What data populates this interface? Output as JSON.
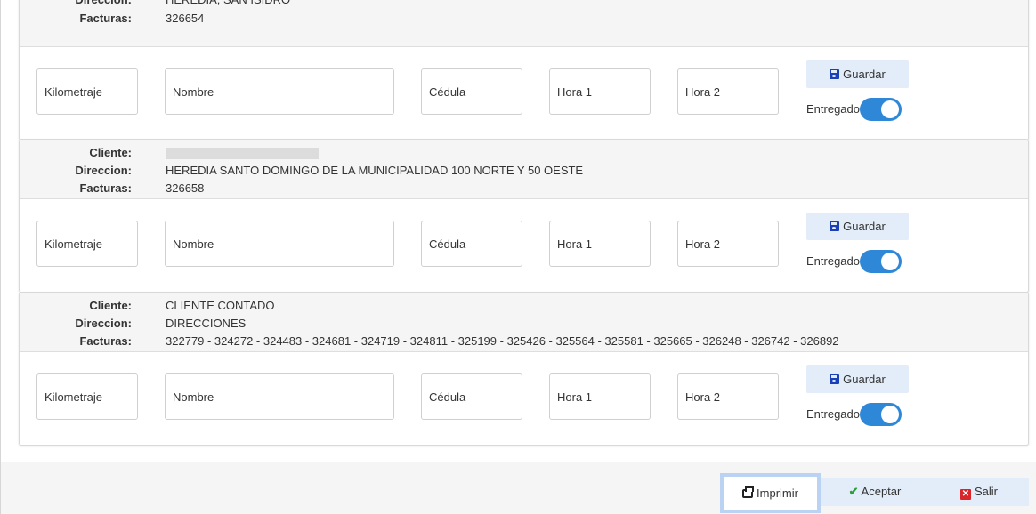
{
  "labels": {
    "cliente": "Cliente:",
    "direccion": "Direccion:",
    "facturas": "Facturas:"
  },
  "fields": {
    "kilometraje": "Kilometraje",
    "nombre": "Nombre",
    "cedula": "Cédula",
    "hora1": "Hora 1",
    "hora2": "Hora 2"
  },
  "buttons": {
    "guardar": "Guardar",
    "entregado": "Entregado"
  },
  "cards": [
    {
      "cliente": "",
      "direccion": "HEREDIA, SAN ISIDRO",
      "facturas": "326654",
      "entregado": true
    },
    {
      "cliente": "",
      "direccion": "HEREDIA SANTO DOMINGO DE LA MUNICIPALIDAD 100 NORTE Y 50 OESTE",
      "facturas": "326658",
      "entregado": true
    },
    {
      "cliente": "CLIENTE CONTADO",
      "direccion": "DIRECCIONES",
      "facturas": "322779 - 324272 - 324483 - 324681 - 324719 - 324811 - 325199 - 325426 - 325564 - 325581 - 325665 - 326248 - 326742 - 326892",
      "entregado": true
    }
  ],
  "footer": {
    "imprimir": "Imprimir",
    "aceptar": "Aceptar",
    "salir": "Salir"
  },
  "colors": {
    "accent": "#2f87d8",
    "button_bg": "#e3ecf9",
    "save_icon": "#1b3fb8",
    "check": "#2e9e3b",
    "close": "#d9262a"
  }
}
